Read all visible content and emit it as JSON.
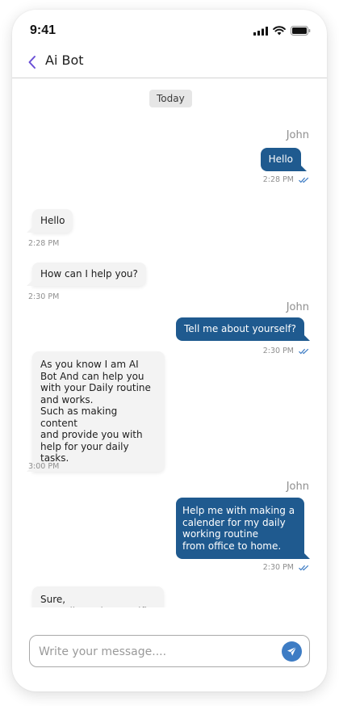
{
  "status_bar": {
    "time": "9:41"
  },
  "header": {
    "title": "Ai Bot"
  },
  "chat": {
    "date_label": "Today",
    "messages": [
      {
        "direction": "out",
        "sender": "John",
        "text": "Hello",
        "time": "2:28 PM",
        "read": true
      },
      {
        "direction": "in",
        "text": "Hello",
        "time": "2:28 PM"
      },
      {
        "direction": "in",
        "text": "How can I help you?",
        "time": "2:30 PM"
      },
      {
        "direction": "out",
        "sender": "John",
        "text": "Tell me about yourself?",
        "time": "2:30 PM",
        "read": true
      },
      {
        "direction": "in",
        "text": "As you know I am AI\nBot And can help you\nwith your Daily routine\nand works.\nSuch as making content\nand provide you with\nhelp for your daily\ntasks.",
        "time": "3:00 PM"
      },
      {
        "direction": "out",
        "sender": "John",
        "text": "Help me with making a\ncalender for my daily\nworking routine\nfrom office to home.",
        "time": "2:30 PM",
        "read": true
      },
      {
        "direction": "in",
        "text": "Sure,\nBut tell me the specific",
        "time": ""
      }
    ]
  },
  "composer": {
    "placeholder": "Write your message...."
  },
  "colors": {
    "outgoing_bubble": "#1f5a8f",
    "incoming_bubble": "#f3f3f3",
    "send_button": "#3d7cc4",
    "read_tick": "#3d7cc4"
  },
  "icons": {
    "back": "chevron-left-icon",
    "signal": "cellular-signal-icon",
    "wifi": "wifi-icon",
    "battery": "battery-icon",
    "read": "double-check-icon",
    "send": "paper-plane-icon"
  }
}
